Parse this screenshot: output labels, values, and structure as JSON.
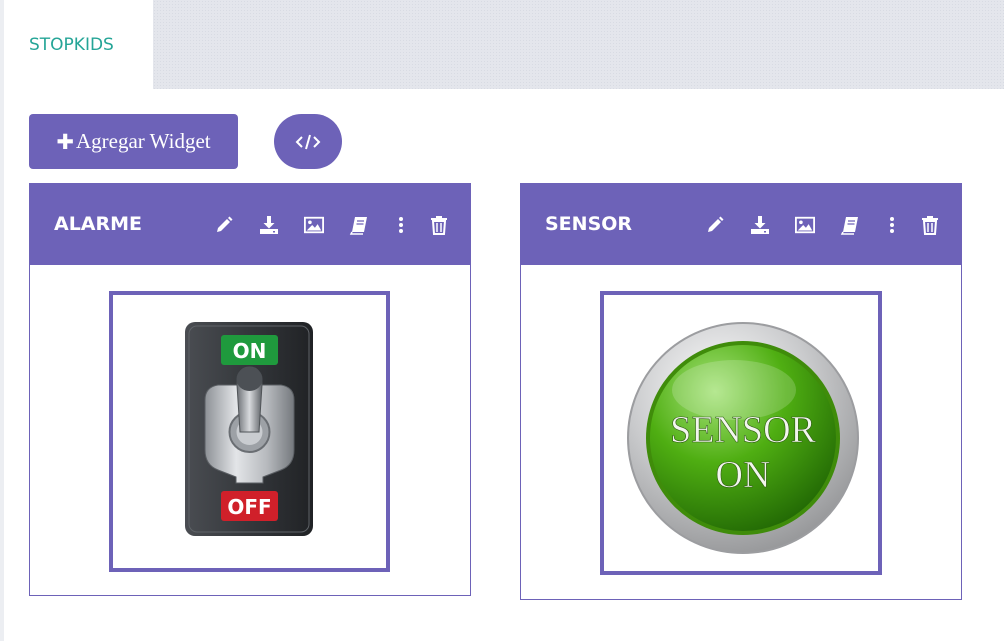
{
  "app": {
    "tab_label": "STOPKIDS"
  },
  "toolbar": {
    "add_widget_label": "Agregar Widget",
    "code_icon": "code-icon"
  },
  "colors": {
    "accent": "#6d62b8",
    "tab_text": "#25a597",
    "tab_strip": "#e4e6ec",
    "switch_on": "#1f9a3d",
    "switch_off": "#d0202a",
    "sensor_green": "#3f9b0b"
  },
  "widgets": [
    {
      "title": "ALARME",
      "tools": [
        "pencil-icon",
        "download-icon",
        "image-icon",
        "book-icon",
        "kebab-icon",
        "trash-icon"
      ],
      "image": {
        "kind": "toggle-switch",
        "on_label": "ON",
        "off_label": "OFF"
      }
    },
    {
      "title": "SENSOR",
      "tools": [
        "pencil-icon",
        "download-icon",
        "image-icon",
        "book-icon",
        "kebab-icon",
        "trash-icon"
      ],
      "image": {
        "kind": "round-button",
        "line1": "SENSOR",
        "line2": "ON"
      }
    }
  ]
}
